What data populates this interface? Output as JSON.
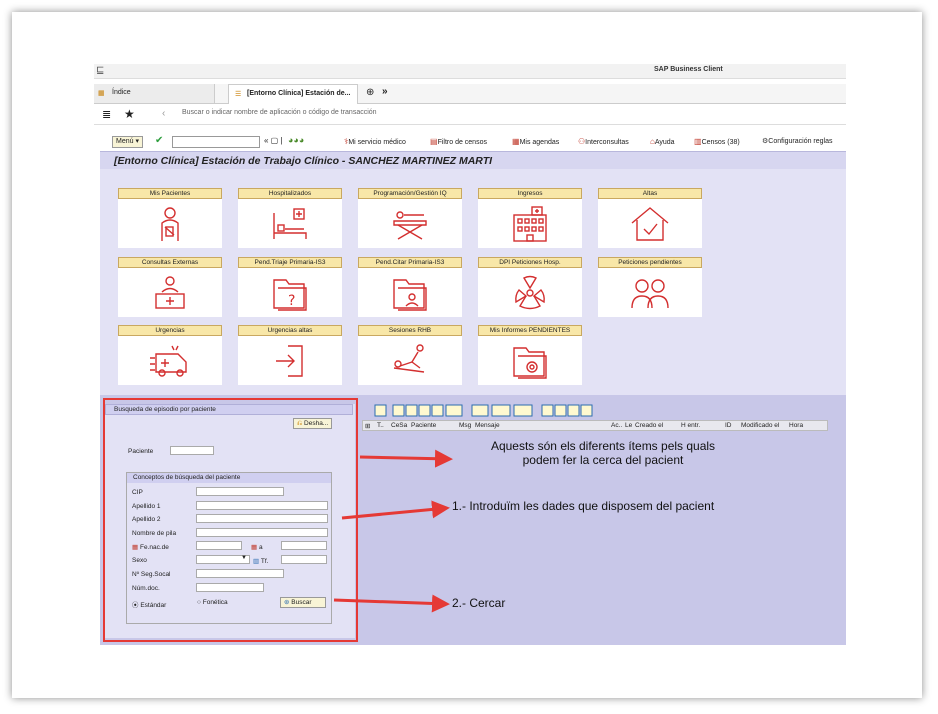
{
  "window": {
    "title": "SAP Business Client"
  },
  "tabs": [
    {
      "label": "Índice"
    },
    {
      "label": "[Entorno Clínica] Estación de..."
    }
  ],
  "nav": {
    "search_placeholder": "Buscar o indicar nombre de aplicación o código de transacción"
  },
  "toolbar": {
    "menu_label": "Menú",
    "items": [
      "Mi servicio médico",
      "Filtro de censos",
      "Mis agendas",
      "Interconsultas",
      "Ayuda",
      "Censos (38)",
      "Configuración reglas"
    ]
  },
  "page_title": "[Entorno Clínica] Estación de Trabajo Clínico - SANCHEZ MARTINEZ MARTI",
  "tiles": [
    {
      "label": "Mis Pacientes",
      "icon": "patient-icon"
    },
    {
      "label": "Hospitalizados",
      "icon": "hospital-bed-icon"
    },
    {
      "label": "Programación/Gestión IQ",
      "icon": "stretcher-icon"
    },
    {
      "label": "Ingresos",
      "icon": "hospital-building-icon"
    },
    {
      "label": "Altas",
      "icon": "house-check-icon"
    },
    {
      "label": "Consultas Externas",
      "icon": "doctor-desk-icon"
    },
    {
      "label": "Pend.Triaje Primaria-IS3",
      "icon": "folder-question-icon"
    },
    {
      "label": "Pend.Citar Primaria-IS3",
      "icon": "folder-person-icon"
    },
    {
      "label": "DPI Peticiones Hosp.",
      "icon": "radiation-icon"
    },
    {
      "label": "Peticiones pendientes",
      "icon": "doctors-icon"
    },
    {
      "label": "Urgencias",
      "icon": "ambulance-icon"
    },
    {
      "label": "Urgencias altas",
      "icon": "exit-icon"
    },
    {
      "label": "Sesiones RHB",
      "icon": "rehab-icon"
    },
    {
      "label": "Mis Informes PENDIENTES",
      "icon": "folder-gear-icon"
    }
  ],
  "search_panel": {
    "title": "Busqueda de episodio por paciente",
    "desha_label": "Desha...",
    "paciente_label": "Paciente",
    "group_title": "Conceptos de búsqueda del paciente",
    "fields": {
      "cip": "CIP",
      "apellido1": "Apellido 1",
      "apellido2": "Apellido 2",
      "nombre": "Nombre de pila",
      "fenac": "Fe.nac.de",
      "a": "a",
      "sexo": "Sexo",
      "tf": "Tf.",
      "nss": "Nº Seg.Socal",
      "numdoc": "Núm.doc."
    },
    "radio_estandar": "Estándar",
    "radio_fonetica": "Fonética",
    "buscar_label": "Buscar"
  },
  "grid": {
    "headers": [
      "T..",
      "CeSa",
      "Paciente",
      "Msg",
      "Mensaje",
      "Ac..",
      "Le",
      "Creado el",
      "H entr.",
      "ID",
      "Modificado el",
      "Hora"
    ]
  },
  "annotations": {
    "note1_line1": "Aquests són els diferents ítems pels quals",
    "note1_line2": "podem fer la cerca del pacient",
    "note2": "1.- Introduïm les dades que disposem del pacient",
    "note3": "2.- Cercar"
  },
  "colors": {
    "accent_red": "#e53935",
    "icon_red": "#d32f2f",
    "header_bg": "#d7d6f0",
    "tile_label_bg": "#f8e7a8"
  }
}
